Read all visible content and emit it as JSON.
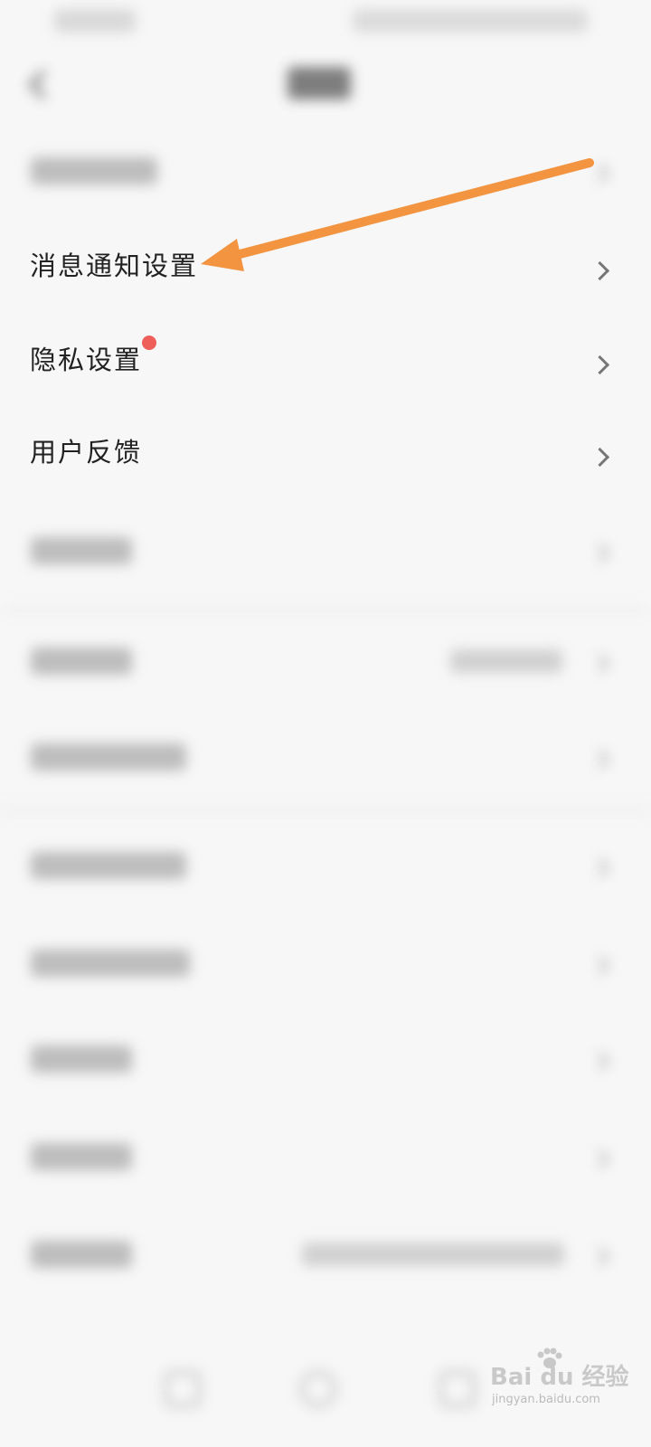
{
  "settings": {
    "items": [
      {
        "label": "消息通知设置"
      },
      {
        "label": "隐私设置"
      },
      {
        "label": "用户反馈"
      }
    ]
  },
  "watermark": {
    "brand": "Bai du 经验",
    "url": "jingyan.baidu.com"
  },
  "colors": {
    "arrow": "#f39441",
    "notification_dot": "#ef5f5a"
  },
  "icons": [
    "back-icon",
    "chevron-right-icon",
    "arrow-annotation",
    "paw-icon"
  ]
}
